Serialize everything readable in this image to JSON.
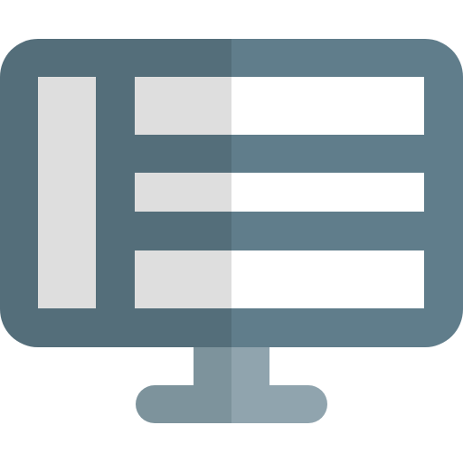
{
  "icon": {
    "name": "monitor-list-layout-icon",
    "colors": {
      "frame_left": "#546e7a",
      "frame_right": "#607d8b",
      "stand_left": "#7d939c",
      "stand_right": "#90a4ae",
      "panel_left": "#dedede",
      "panel_right": "#ffffff",
      "background": "#ffffff"
    }
  }
}
